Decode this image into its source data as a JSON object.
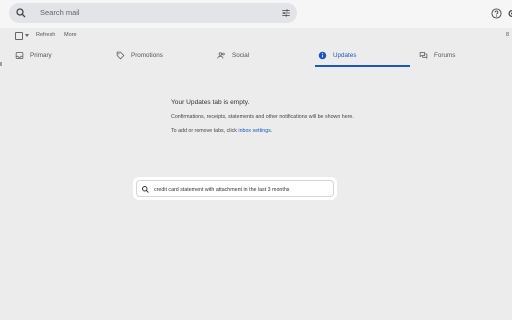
{
  "search": {
    "placeholder": "Search mail"
  },
  "toolbar": {
    "refresh": "Refresh",
    "more": "More",
    "edge": "8"
  },
  "tabs": [
    {
      "label": "Primary",
      "icon": "inbox-icon",
      "active": false
    },
    {
      "label": "Promotions",
      "icon": "tag-icon",
      "active": false
    },
    {
      "label": "Social",
      "icon": "people-icon",
      "active": false
    },
    {
      "label": "Updates",
      "icon": "info-icon",
      "active": true
    },
    {
      "label": "Forums",
      "icon": "forum-icon",
      "active": false
    }
  ],
  "empty_state": {
    "title": "Your Updates tab is empty.",
    "description": "Confirmations, receipts, statements and other notifications will be shown here.",
    "manage_prefix": "To add or remove tabs, click ",
    "manage_link": "inbox settings",
    "manage_suffix": "."
  },
  "suggestion": {
    "query": "credit card statement with attachment in the last 3 months"
  },
  "colors": {
    "accent": "#1a56c4",
    "background": "#ececec",
    "search_bg": "#e3e4e8"
  }
}
